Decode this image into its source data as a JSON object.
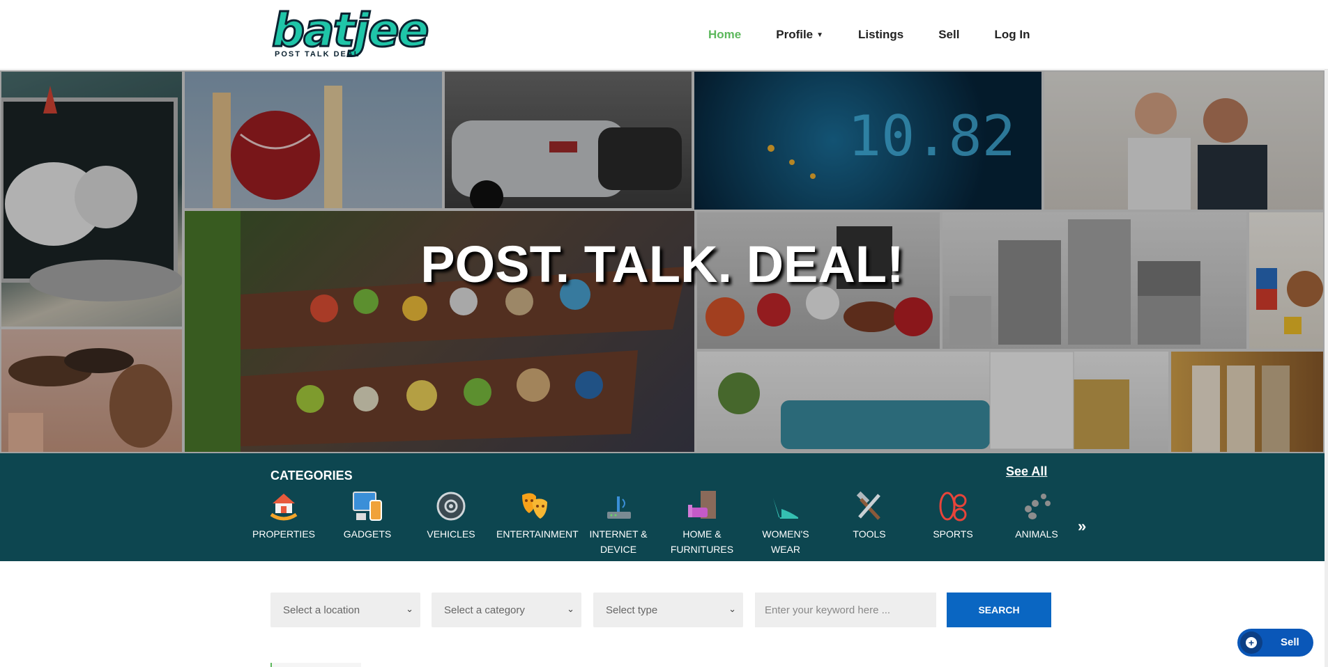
{
  "brand": {
    "name": "batjee",
    "tagline": "POST TALK DEAL"
  },
  "nav": {
    "items": [
      {
        "label": "Home",
        "active": true
      },
      {
        "label": "Profile",
        "dropdown": true
      },
      {
        "label": "Listings"
      },
      {
        "label": "Sell"
      },
      {
        "label": "Log In"
      }
    ]
  },
  "hero": {
    "title": "POST. TALK. DEAL!"
  },
  "categories": {
    "title": "CATEGORIES",
    "see_all": "See All",
    "items": [
      {
        "label": "PROPERTIES",
        "icon": "house-hand-icon"
      },
      {
        "label": "GADGETS",
        "icon": "devices-icon"
      },
      {
        "label": "VEHICLES",
        "icon": "tire-icon"
      },
      {
        "label": "ENTERTAINMENT",
        "icon": "theater-masks-icon"
      },
      {
        "label": "INTERNET & DEVICE",
        "icon": "router-icon"
      },
      {
        "label": "HOME & FURNITURES",
        "icon": "furniture-icon"
      },
      {
        "label": "WOMEN'S WEAR",
        "icon": "high-heel-icon"
      },
      {
        "label": "TOOLS",
        "icon": "tools-icon"
      },
      {
        "label": "SPORTS",
        "icon": "sports-balls-icon"
      },
      {
        "label": "ANIMALS",
        "icon": "paw-icon"
      }
    ]
  },
  "search": {
    "location_placeholder": "Select a location",
    "category_placeholder": "Select a category",
    "type_placeholder": "Select type",
    "keyword_placeholder": "Enter your keyword here ...",
    "button_label": "SEARCH"
  },
  "floating": {
    "sell_label": "Sell"
  },
  "colors": {
    "nav_active": "#5cb85c",
    "category_band": "#0d4650",
    "search_button": "#0a66c2"
  }
}
